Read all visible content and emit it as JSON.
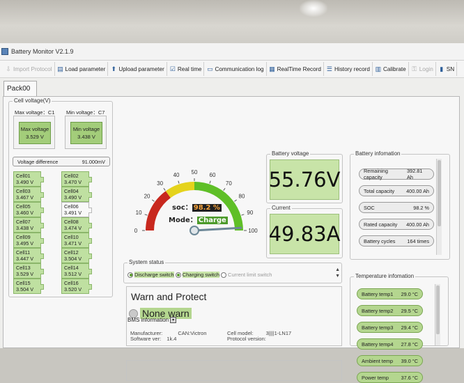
{
  "window": {
    "title": "Battery Monitor V2.1.9"
  },
  "toolbar": [
    {
      "label": "Import Protocol",
      "icon": "import-icon",
      "disabled": true
    },
    {
      "label": "Load parameter",
      "icon": "document-icon",
      "disabled": false
    },
    {
      "label": "Upload parameter",
      "icon": "up-arrow-icon",
      "disabled": false
    },
    {
      "label": "Real time",
      "icon": "checkbox-icon",
      "disabled": false
    },
    {
      "label": "Communication log",
      "icon": "monitor-icon",
      "disabled": false
    },
    {
      "label": "RealTime Record",
      "icon": "chart-icon",
      "disabled": false
    },
    {
      "label": "History record",
      "icon": "list-icon",
      "disabled": false
    },
    {
      "label": "Calibrate",
      "icon": "ruler-icon",
      "disabled": false
    },
    {
      "label": "Login",
      "icon": "key-icon",
      "disabled": true
    },
    {
      "label": "SN",
      "icon": "barcode-icon",
      "disabled": false
    }
  ],
  "tabs": [
    "Pack00"
  ],
  "cell_voltage": {
    "title": "Cell voltage(V)",
    "max_label": "Max voltage：C1",
    "max_box_label": "Max voltage",
    "max_value": "3.529 V",
    "min_label": "Min voltage：C7",
    "min_box_label": "Min voltage",
    "min_value": "3.438 V",
    "diff_label": "Voltage difference",
    "diff_value": "91.000mV",
    "cells": [
      {
        "name": "Cell01",
        "value": "3.490 V"
      },
      {
        "name": "Cell02",
        "value": "3.470 V"
      },
      {
        "name": "Cell03",
        "value": "3.467 V"
      },
      {
        "name": "Cell04",
        "value": "3.490 V"
      },
      {
        "name": "Cell05",
        "value": "3.460 V"
      },
      {
        "name": "Cell06",
        "value": "3.491 V"
      },
      {
        "name": "Cell07",
        "value": "3.438 V"
      },
      {
        "name": "Cell08",
        "value": "3.474 V"
      },
      {
        "name": "Cell09",
        "value": "3.495 V"
      },
      {
        "name": "Cell10",
        "value": "3.471 V"
      },
      {
        "name": "Cell11",
        "value": "3.447 V"
      },
      {
        "name": "Cell12",
        "value": "3.504 V"
      },
      {
        "name": "Cell13",
        "value": "3.529 V"
      },
      {
        "name": "Cell14",
        "value": "3.512 V"
      },
      {
        "name": "Cell15",
        "value": "3.504 V"
      },
      {
        "name": "Cell16",
        "value": "3.520 V"
      }
    ]
  },
  "gauge": {
    "ticks": [
      "0",
      "10",
      "20",
      "30",
      "40",
      "50",
      "60",
      "70",
      "80",
      "90",
      "100"
    ],
    "soc_label": "soc：",
    "soc_value": "98.2 %",
    "mode_label": "Mode：",
    "mode_value": "Charge",
    "needle_value": 98.2,
    "zone_colors": [
      "#c8281e",
      "#e5d31c",
      "#5fbf27"
    ]
  },
  "battery_voltage": {
    "label": "Battery voltage",
    "value": "55.76V"
  },
  "current": {
    "label": "Current",
    "value": "49.83A"
  },
  "battery_info": {
    "title": "Battery infomation",
    "items": [
      {
        "label": "Remaining capacity",
        "value": "392.81 Ah"
      },
      {
        "label": "Total capacity",
        "value": "400.00 Ah"
      },
      {
        "label": "SOC",
        "value": "98.2 %"
      },
      {
        "label": "Rated capacity",
        "value": "400.00 Ah"
      },
      {
        "label": "Battery cycles",
        "value": "164 times"
      }
    ]
  },
  "system_status": {
    "title": "System status",
    "switches": [
      {
        "label": "Discharge switch",
        "on": true
      },
      {
        "label": "Charging switch",
        "on": true
      },
      {
        "label": "Current limit switch",
        "on": false
      }
    ]
  },
  "warn": {
    "title": "Warn and Protect",
    "status": "None warn"
  },
  "temperature": {
    "title": "Temperature infomation",
    "items": [
      {
        "label": "Battery temp1",
        "value": "29.0 °C"
      },
      {
        "label": "Battery temp2",
        "value": "29.5 °C"
      },
      {
        "label": "Battery temp3",
        "value": "29.4 °C"
      },
      {
        "label": "Battery temp4",
        "value": "27.8 °C"
      },
      {
        "label": "Ambient temp",
        "value": "39.0 °C"
      },
      {
        "label": "Power temp",
        "value": "37.6 °C"
      }
    ]
  },
  "bms_info": {
    "title": "BMS information",
    "manufacturer_label": "Manufacturer:",
    "manufacturer_value": "CAN:Victron",
    "software_label": "Software ver:",
    "software_value": "1k.4",
    "cell_model_label": "Cell model:",
    "cell_model_value": "3||||1-LN17",
    "protocol_label": "Protocol version:",
    "protocol_value": ""
  },
  "colors": {
    "cell_green": "#bfe0a1",
    "big_green": "#c8e4a8",
    "pill_green": "#b4d68f"
  }
}
